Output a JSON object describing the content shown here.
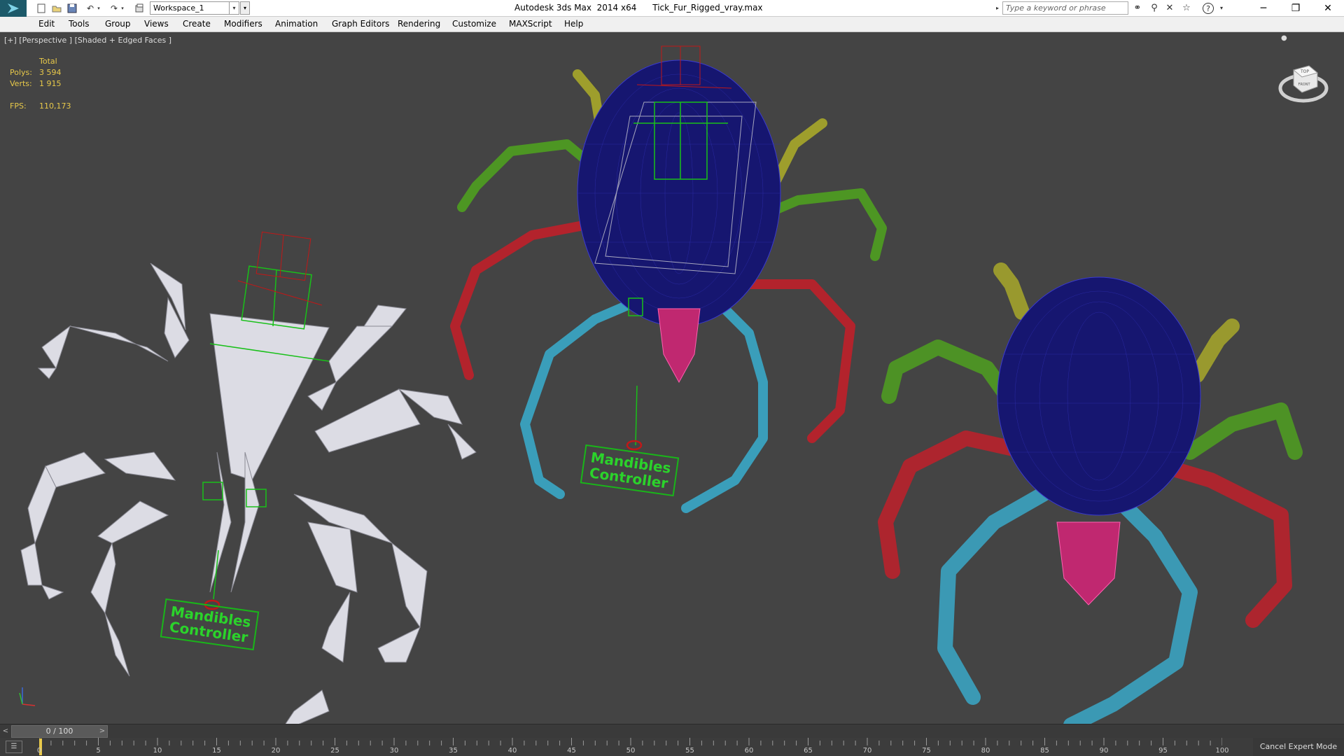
{
  "titlebar": {
    "app_title": "Autodesk 3ds Max  2014 x64",
    "file_name": "Tick_Fur_Rigged_vray.max",
    "workspace_value": "Workspace_1",
    "search_placeholder": "Type a keyword or phrase"
  },
  "quick_access": {
    "icons": [
      "new-file-icon",
      "open-icon",
      "save-icon",
      "undo-icon",
      "redo-icon",
      "project-folder-icon"
    ]
  },
  "menu": {
    "items": [
      "Edit",
      "Tools",
      "Group",
      "Views",
      "Create",
      "Modifiers",
      "Animation",
      "Graph Editors",
      "Rendering",
      "Customize",
      "MAXScript",
      "Help"
    ]
  },
  "viewport": {
    "label": "[+] [Perspective ] [Shaded + Edged Faces ]",
    "stats": {
      "header": "Total",
      "polys_label": "Polys:",
      "polys_value": "3 594",
      "verts_label": "Verts:",
      "verts_value": "1 915",
      "fps_label": "FPS:",
      "fps_value": "110,173"
    },
    "viewcube": {
      "top": "TOP",
      "front": "FRONT"
    },
    "controller_label_line1": "Mandibles",
    "controller_label_line2": "Controller",
    "colors": {
      "background": "#444444",
      "body": "#1a1a6e",
      "leg_red": "#c0202a",
      "leg_green": "#4fa020",
      "leg_yellow": "#a8a82a",
      "leg_cyan": "#3aa8c8",
      "mandible": "#d0307a",
      "bones": "#d8d8e0",
      "helper_green": "#19c019",
      "helper_red": "#c01818"
    }
  },
  "timeslider": {
    "value": "0 / 100"
  },
  "trackbar": {
    "ticks": [
      "0",
      "5",
      "10",
      "15",
      "20",
      "25",
      "30",
      "35",
      "40",
      "45",
      "50",
      "55",
      "60",
      "65",
      "70",
      "75",
      "80",
      "85",
      "90",
      "95",
      "100"
    ],
    "cancel_expert": "Cancel Expert Mode"
  }
}
